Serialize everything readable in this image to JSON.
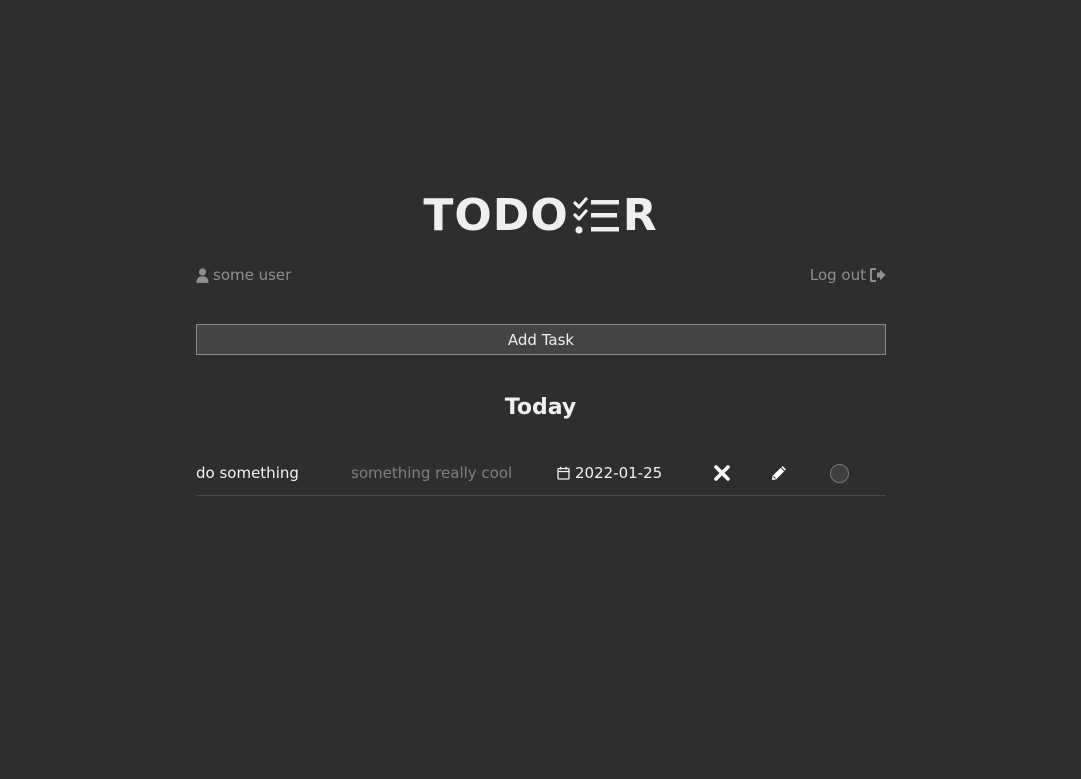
{
  "app": {
    "logo_text": "TODO",
    "logo_text_end": "R"
  },
  "user": {
    "name": "some user",
    "logout_label": "Log out"
  },
  "actions": {
    "add_task_label": "Add Task"
  },
  "sections": [
    {
      "title": "Today",
      "tasks": [
        {
          "title": "do something",
          "description": "something really cool",
          "due_date": "2022-01-25",
          "completed": false
        }
      ]
    }
  ],
  "icons": {
    "user": "user-icon",
    "logout": "sign-out-icon",
    "calendar": "calendar-icon",
    "delete": "close-icon",
    "edit": "pencil-icon",
    "complete": "circle-checkbox-icon",
    "logo_list": "checklist-icon"
  },
  "colors": {
    "background": "#2e2e2e",
    "text": "#eeeeee",
    "muted": "#8f8f8f",
    "button_bg": "#444444",
    "button_border": "#8a8a8a",
    "divider": "#4a4a4a"
  }
}
